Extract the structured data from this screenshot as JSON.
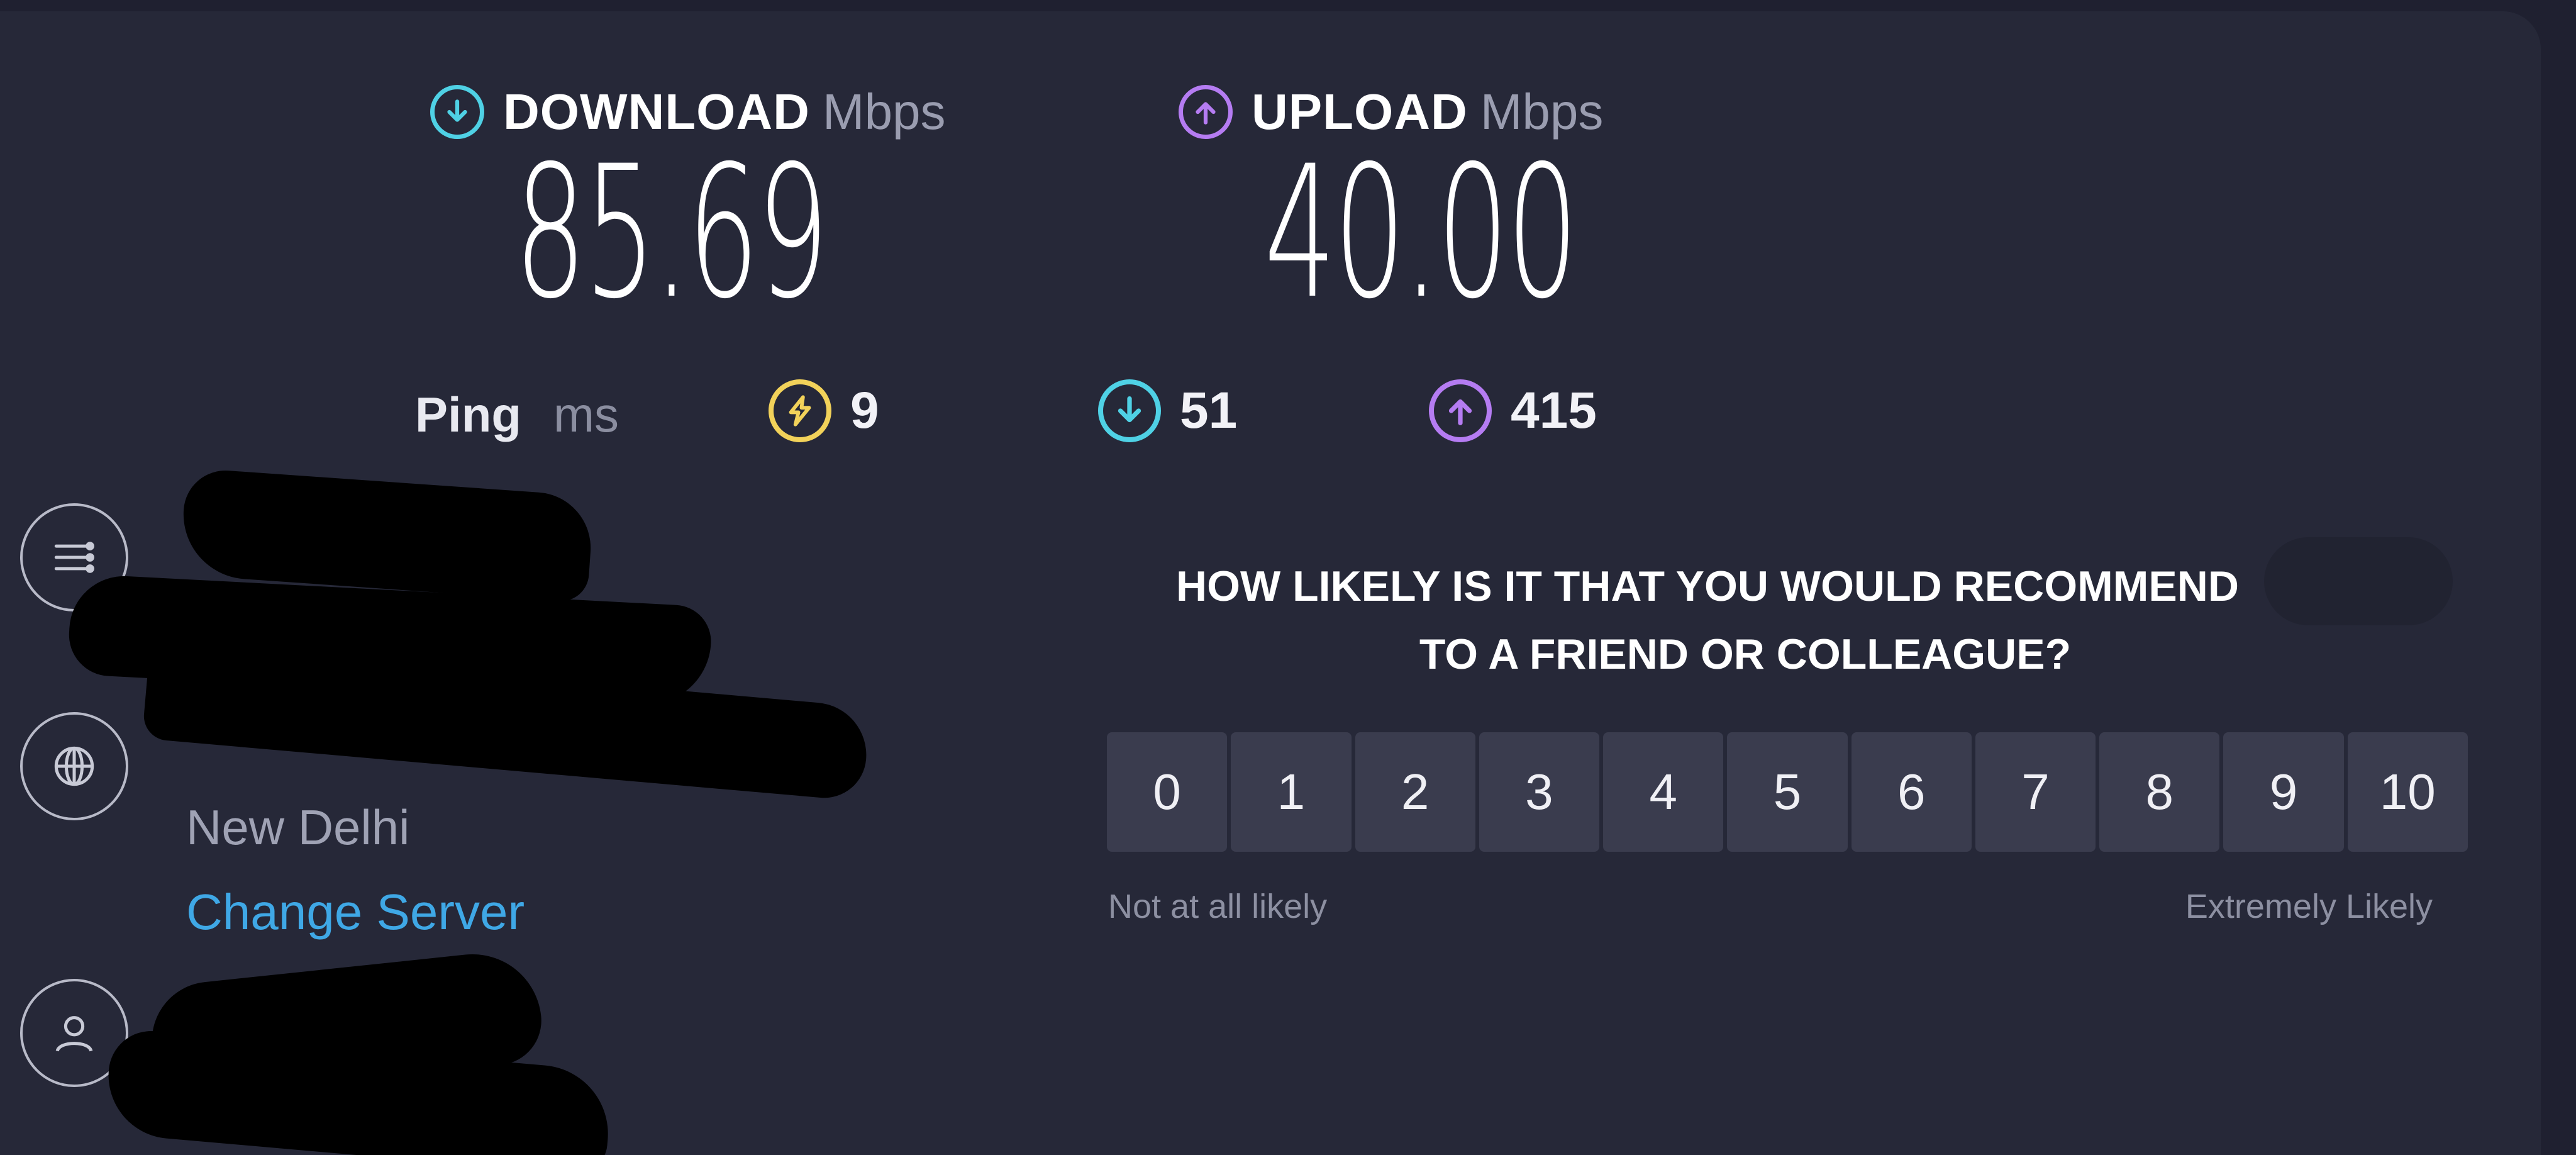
{
  "download": {
    "label": "DOWNLOAD",
    "unit": "Mbps",
    "value": "85.69",
    "icon": "download-arrow-icon",
    "color": "#4fd1e5"
  },
  "upload": {
    "label": "UPLOAD",
    "unit": "Mbps",
    "value": "40.00",
    "icon": "upload-arrow-icon",
    "color": "#b57cf2"
  },
  "ping": {
    "label": "Ping",
    "unit": "ms",
    "idle": {
      "value": "9",
      "icon": "lightning-icon",
      "color": "#f2d25a"
    },
    "download": {
      "value": "51",
      "icon": "download-arrow-icon",
      "color": "#4fd1e5"
    },
    "upload": {
      "value": "415",
      "icon": "upload-arrow-icon",
      "color": "#b57cf2"
    }
  },
  "server": {
    "location": "New Delhi",
    "change_label": "Change Server"
  },
  "sidebar_icons": [
    "connections-icon",
    "globe-icon",
    "user-icon"
  ],
  "survey": {
    "question_line1": "HOW LIKELY IS IT THAT YOU WOULD RECOMMEND",
    "question_line2": "TO A FRIEND OR COLLEAGUE?",
    "scale": [
      "0",
      "1",
      "2",
      "3",
      "4",
      "5",
      "6",
      "7",
      "8",
      "9",
      "10"
    ],
    "low_label": "Not at all likely",
    "high_label": "Extremely Likely"
  }
}
